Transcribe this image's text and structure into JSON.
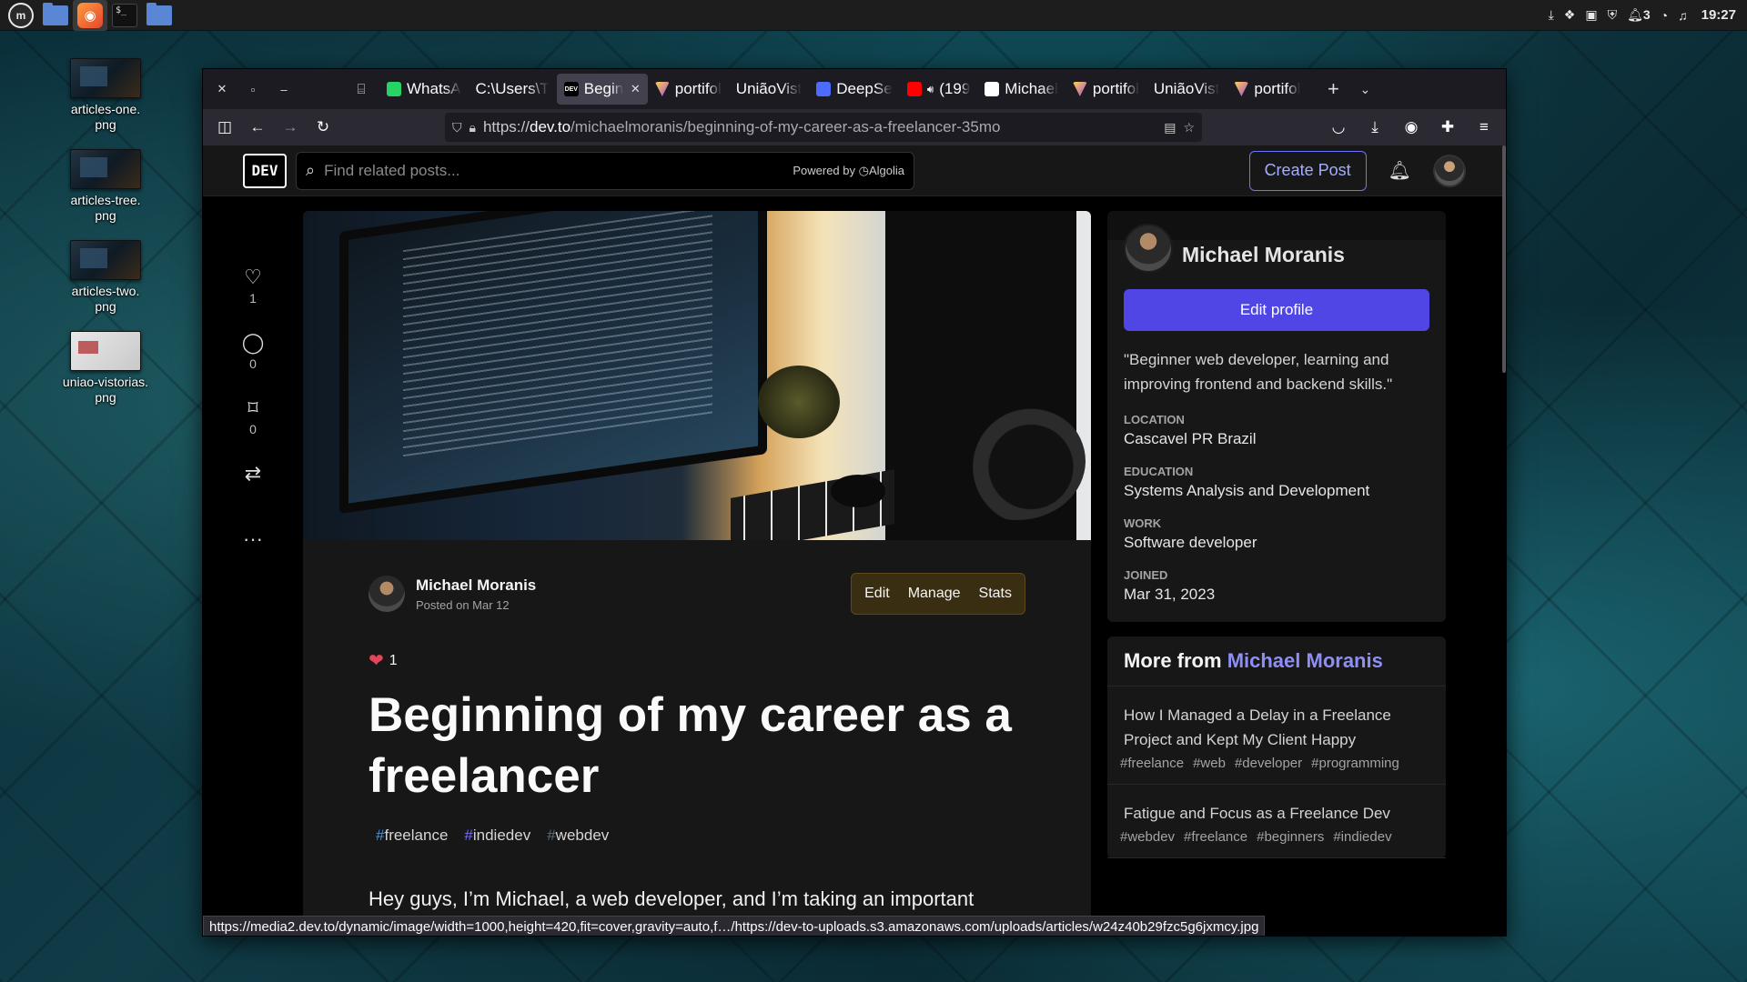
{
  "desktop": {
    "icons": [
      {
        "label": "articles-one.\npng",
        "line1": "articles-one.",
        "line2": "png"
      },
      {
        "label": "articles-tree.png",
        "line1": "articles-tree.",
        "line2": "png"
      },
      {
        "label": "articles-two.png",
        "line1": "articles-two.",
        "line2": "png"
      },
      {
        "label": "uniao-vistorias.png",
        "line1": "uniao-vistorias.",
        "line2": "png"
      }
    ]
  },
  "panel": {
    "notifications_count": "3",
    "clock": "19:27"
  },
  "browser": {
    "tabs": [
      {
        "title": "WhatsA",
        "icon": "whatsapp-icon"
      },
      {
        "title": "C:\\Users\\T",
        "icon": "none"
      },
      {
        "title": "Begin",
        "icon": "dev-icon",
        "active": true
      },
      {
        "title": "portifol",
        "icon": "v-icon"
      },
      {
        "title": "UniãoVist",
        "icon": "none"
      },
      {
        "title": "DeepSe",
        "icon": "deepseek-icon"
      },
      {
        "title": "(199",
        "icon": "youtube-icon"
      },
      {
        "title": "Michael",
        "icon": "github-icon"
      },
      {
        "title": "portifol",
        "icon": "v-icon"
      },
      {
        "title": "UniãoVist",
        "icon": "none"
      },
      {
        "title": "portifol",
        "icon": "v-icon"
      }
    ],
    "url_prefix": "https://",
    "url_host": "dev.to",
    "url_path": "/michaelmoranis/beginning-of-my-career-as-a-freelancer-35mo",
    "status_url": "https://media2.dev.to/dynamic/image/width=1000,height=420,fit=cover,gravity=auto,f…/https://dev-to-uploads.s3.amazonaws.com/uploads/articles/w24z40b29fzc5g6jxmcy.jpg"
  },
  "devto": {
    "logo": "DEV",
    "search_placeholder": "Find related posts...",
    "powered_by": "Powered by",
    "algolia": "Algolia",
    "create_post": "Create Post",
    "actions": {
      "likes": "1",
      "comments": "0",
      "bookmarks": "0"
    },
    "article": {
      "author": "Michael Moranis",
      "posted": "Posted on Mar 12",
      "owner_actions": [
        "Edit",
        "Manage",
        "Stats"
      ],
      "reaction_count": "1",
      "title": "Beginning of my career as a freelancer",
      "tags": [
        {
          "hash": "#",
          "name": "freelance"
        },
        {
          "hash": "#",
          "name": "indiedev"
        },
        {
          "hash": "#",
          "name": "webdev"
        }
      ],
      "body_first_line": "Hey guys, I’m Michael, a web developer, and I’m taking an important"
    },
    "profile": {
      "name": "Michael Moranis",
      "edit_button": "Edit profile",
      "bio": "\"Beginner web developer, learning and improving frontend and backend skills.\"",
      "fields": [
        {
          "label": "LOCATION",
          "value": "Cascavel PR Brazil"
        },
        {
          "label": "EDUCATION",
          "value": "Systems Analysis and Development"
        },
        {
          "label": "WORK",
          "value": "Software developer"
        },
        {
          "label": "JOINED",
          "value": "Mar 31, 2023"
        }
      ]
    },
    "more_from": {
      "prefix": "More from",
      "author": "Michael Moranis",
      "items": [
        {
          "title": "How I Managed a Delay in a Freelance Project and Kept My Client Happy",
          "tags": [
            "#freelance",
            "#web",
            "#developer",
            "#programming"
          ]
        },
        {
          "title": "Fatigue and Focus as a Freelance Dev",
          "tags": [
            "#webdev",
            "#freelance",
            "#beginners",
            "#indiedev"
          ]
        }
      ]
    }
  }
}
